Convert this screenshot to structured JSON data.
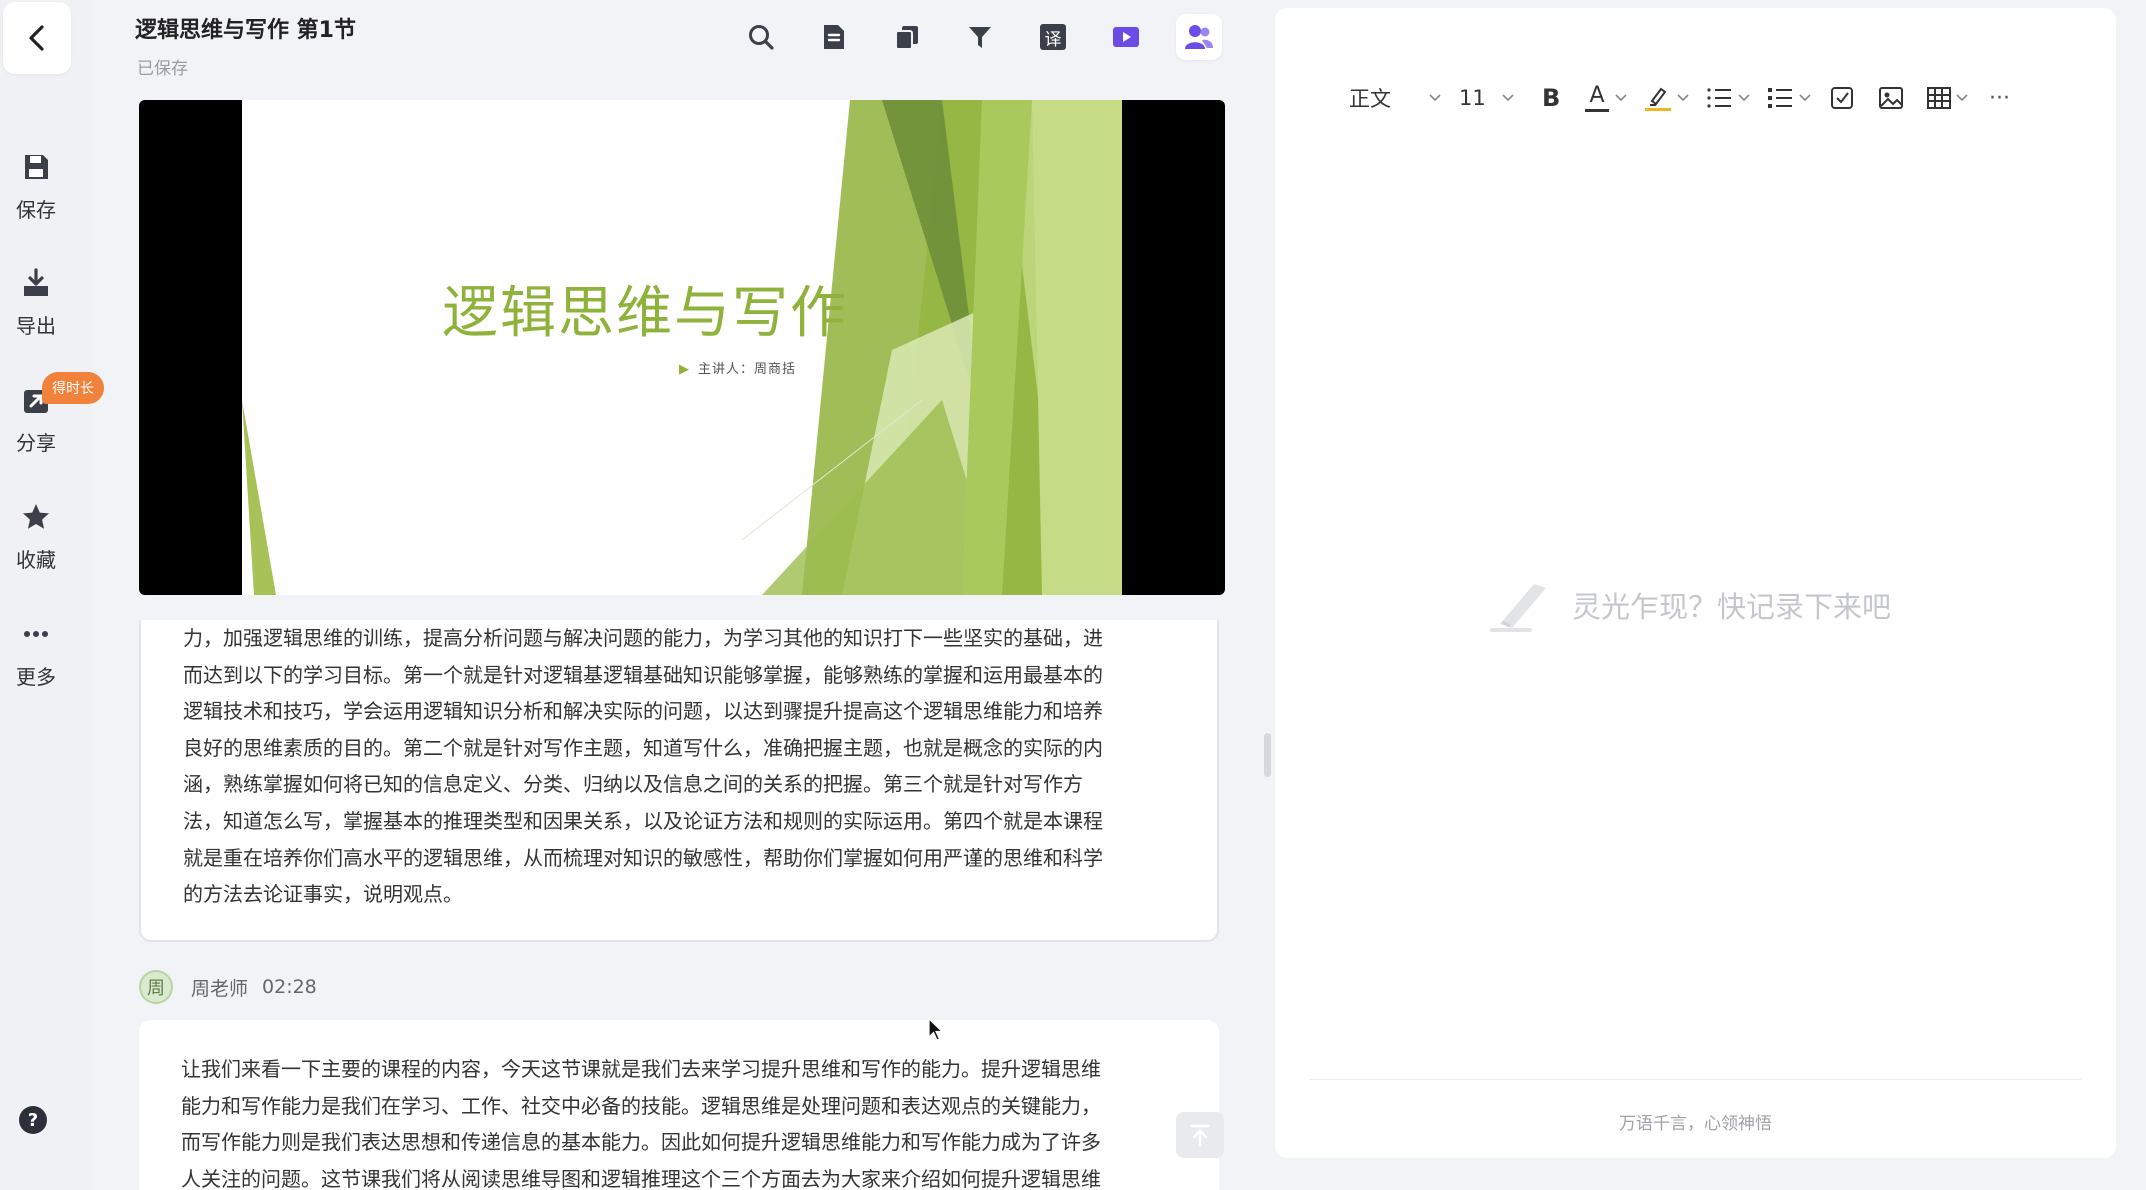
{
  "sidebar": {
    "back_icon": "chevron-left-icon",
    "items": [
      {
        "label": "保存",
        "icon": "save-icon"
      },
      {
        "label": "导出",
        "icon": "download-icon"
      },
      {
        "label": "分享",
        "icon": "share-icon"
      },
      {
        "label": "收藏",
        "icon": "star-icon"
      },
      {
        "label": "更多",
        "icon": "more-icon"
      }
    ],
    "share_badge": "得时长",
    "help_icon": "help-icon"
  },
  "header": {
    "title": "逻辑思维与写作 第1节",
    "save_status": "已保存",
    "tools": [
      "search-icon",
      "notes-icon",
      "copy-icon",
      "filter-icon",
      "translate-icon",
      "video-icon",
      "people-icon"
    ],
    "translate_glyph": "译"
  },
  "video": {
    "slide_title": "逻辑思维与写作",
    "slide_subtitle": "主讲人：周商括",
    "accent": "#8fb23b"
  },
  "transcript": {
    "segment1": {
      "lines": [
        "力，加强逻辑思维的训练，提高分析问题与解决问题的能力，为学习其他的知识打下一些坚实的基础，进",
        "而达到以下的学习目标。第一个就是针对逻辑基逻辑基础知识能够掌握，能够熟练的掌握和运用最基本的",
        "逻辑技术和技巧，学会运用逻辑知识分析和解决实际的问题，以达到骤提升提高这个逻辑思维能力和培养",
        "良好的思维素质的目的。第二个就是针对写作主题，知道写什么，准确把握主题，也就是概念的实际的内",
        "涵，熟练掌握如何将已知的信息定义、分类、归纳以及信息之间的关系的把握。第三个就是针对写作方",
        "法，知道怎么写，掌握基本的推理类型和因果关系，以及论证方法和规则的实际运用。第四个就是本课程",
        "就是重在培养你们高水平的逻辑思维，从而梳理对知识的敏感性，帮助你们掌握如何用严谨的思维和科学",
        "的方法去论证事实，说明观点。"
      ]
    },
    "speaker": {
      "avatar": "周",
      "name": "周老师",
      "time": "02:28"
    },
    "segment2": {
      "lines": [
        "让我们来看一下主要的课程的内容，今天这节课就是我们去来学习提升思维和写作的能力。提升逻辑思维",
        "能力和写作能力是我们在学习、工作、社交中必备的技能。逻辑思维是处理问题和表达观点的关键能力，",
        "而写作能力则是我们表达思想和传递信息的基本能力。因此如何提升逻辑思维能力和写作能力成为了许多",
        "人关注的问题。这节课我们将从阅读思维导图和逻辑推理这个三个方面去为大家来介绍如何提升逻辑思维"
      ]
    },
    "back_to_top_icon": "arrow-up-icon"
  },
  "editor": {
    "toolbar": {
      "style": "正文",
      "font_size": "11",
      "bold": "B",
      "font_color_glyph": "A",
      "font_color": "#333333",
      "highlight_color": "#f0b429",
      "more": "···"
    },
    "placeholder": "灵光乍现？快记录下来吧",
    "footer": "万语千言，心领神悟"
  },
  "colors": {
    "accent_purple": "#6b4ce6",
    "badge_orange": "#f0823b"
  }
}
